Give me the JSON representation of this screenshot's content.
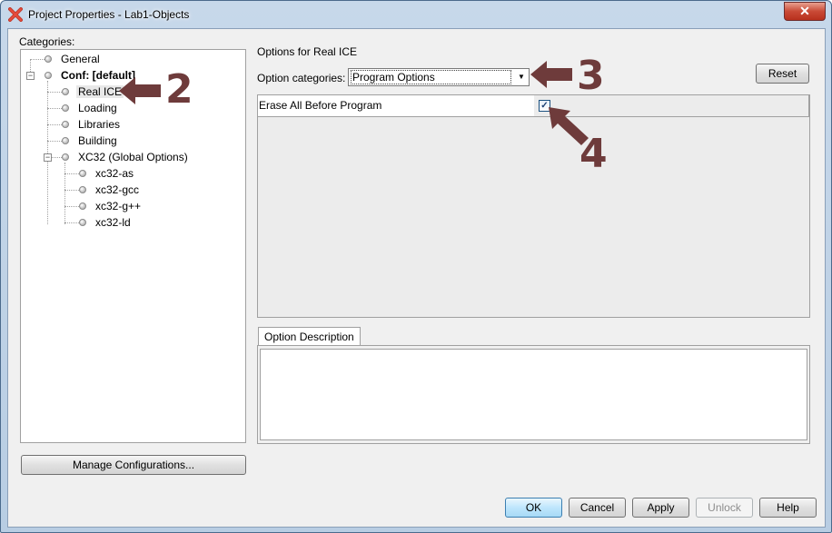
{
  "window": {
    "title": "Project Properties - Lab1-Objects",
    "close_label": "✕"
  },
  "categories": {
    "label": "Categories:",
    "items": [
      {
        "label": "General"
      },
      {
        "label": "Conf: [default]"
      },
      {
        "label": "Real ICE"
      },
      {
        "label": "Loading"
      },
      {
        "label": "Libraries"
      },
      {
        "label": "Building"
      },
      {
        "label": "XC32 (Global Options)"
      },
      {
        "label": "xc32-as"
      },
      {
        "label": "xc32-gcc"
      },
      {
        "label": "xc32-g++"
      },
      {
        "label": "xc32-ld"
      }
    ],
    "manage_button": "Manage Configurations..."
  },
  "options": {
    "header": "Options for Real ICE",
    "category_label": "Option categories:",
    "category_value": "Program Options",
    "reset_button": "Reset",
    "rows": [
      {
        "name": "Erase All Before Program",
        "checked": true
      }
    ],
    "description_tab": "Option Description"
  },
  "footer": {
    "ok": "OK",
    "cancel": "Cancel",
    "apply": "Apply",
    "unlock": "Unlock",
    "help": "Help"
  },
  "callouts": {
    "step2": "2",
    "step3": "3",
    "step4": "4",
    "color": "#6e3b3b"
  }
}
